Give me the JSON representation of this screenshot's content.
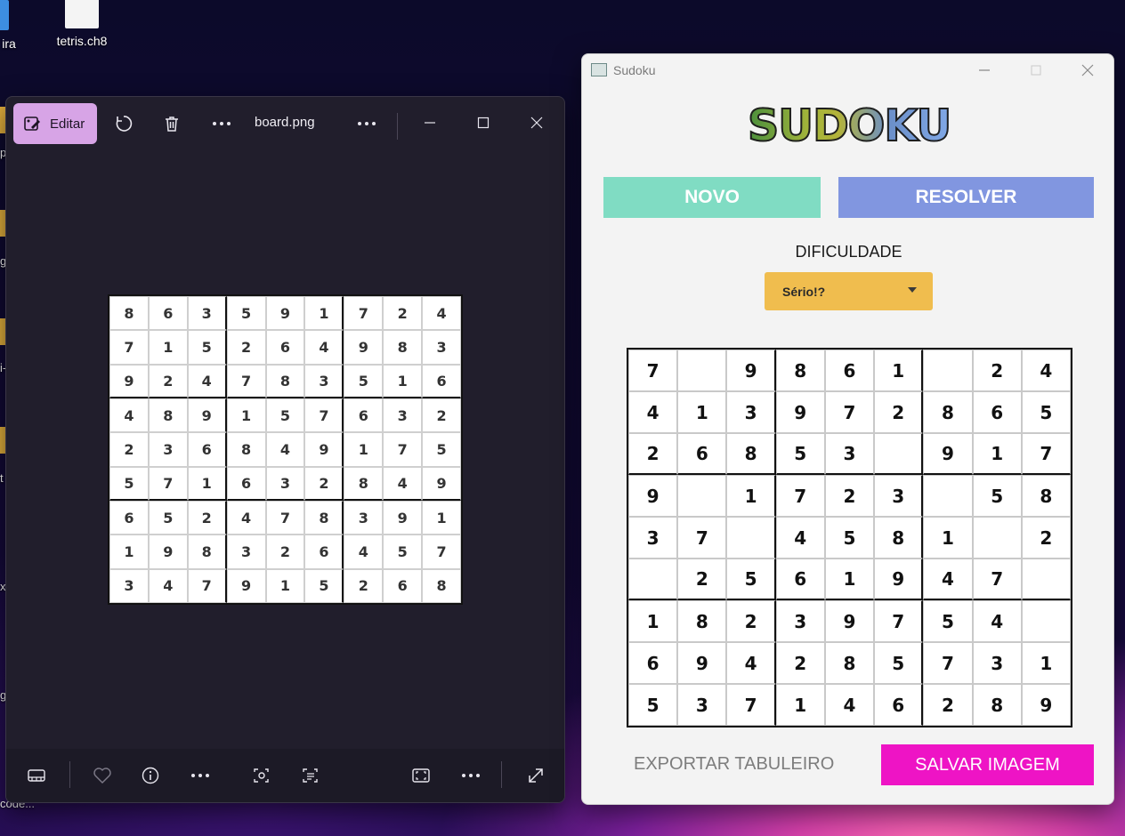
{
  "desktop": {
    "icons": [
      {
        "label": "ira"
      },
      {
        "label": "tetris.ch8"
      }
    ],
    "edge_labels": [
      "p",
      "g",
      "i-",
      "t",
      "x-",
      "g",
      "code..."
    ]
  },
  "viewer": {
    "edit_label": "Editar",
    "filename": "board.png",
    "grid": [
      [
        8,
        6,
        3,
        5,
        9,
        1,
        7,
        2,
        4
      ],
      [
        7,
        1,
        5,
        2,
        6,
        4,
        9,
        8,
        3
      ],
      [
        9,
        2,
        4,
        7,
        8,
        3,
        5,
        1,
        6
      ],
      [
        4,
        8,
        9,
        1,
        5,
        7,
        6,
        3,
        2
      ],
      [
        2,
        3,
        6,
        8,
        4,
        9,
        1,
        7,
        5
      ],
      [
        5,
        7,
        1,
        6,
        3,
        2,
        8,
        4,
        9
      ],
      [
        6,
        5,
        2,
        4,
        7,
        8,
        3,
        9,
        1
      ],
      [
        1,
        9,
        8,
        3,
        2,
        6,
        4,
        5,
        7
      ],
      [
        3,
        4,
        7,
        9,
        1,
        5,
        2,
        6,
        8
      ]
    ]
  },
  "app": {
    "title": "Sudoku",
    "logo": "SUDOKU",
    "novo_label": "NOVO",
    "resolver_label": "RESOLVER",
    "difficulty_label": "DIFICULDADE",
    "difficulty_value": "Sério!?",
    "export_label": "EXPORTAR TABULEIRO",
    "save_label": "SALVAR IMAGEM",
    "grid": [
      [
        "7",
        "",
        "9",
        "8",
        "6",
        "1",
        "",
        "2",
        "4"
      ],
      [
        "4",
        "1",
        "3",
        "9",
        "7",
        "2",
        "8",
        "6",
        "5"
      ],
      [
        "2",
        "6",
        "8",
        "5",
        "3",
        "",
        "9",
        "1",
        "7"
      ],
      [
        "9",
        "",
        "1",
        "7",
        "2",
        "3",
        "",
        "5",
        "8"
      ],
      [
        "3",
        "7",
        "",
        "4",
        "5",
        "8",
        "1",
        "",
        "2"
      ],
      [
        "",
        "2",
        "5",
        "6",
        "1",
        "9",
        "4",
        "7",
        ""
      ],
      [
        "1",
        "8",
        "2",
        "3",
        "9",
        "7",
        "5",
        "4",
        ""
      ],
      [
        "6",
        "9",
        "4",
        "2",
        "8",
        "5",
        "7",
        "3",
        "1"
      ],
      [
        "5",
        "3",
        "7",
        "1",
        "4",
        "6",
        "2",
        "8",
        "9"
      ]
    ]
  },
  "colors": {
    "novo": "#80dcc3",
    "resolver": "#8196e0",
    "difficulty": "#f0bd4e",
    "save": "#ee14c5"
  }
}
